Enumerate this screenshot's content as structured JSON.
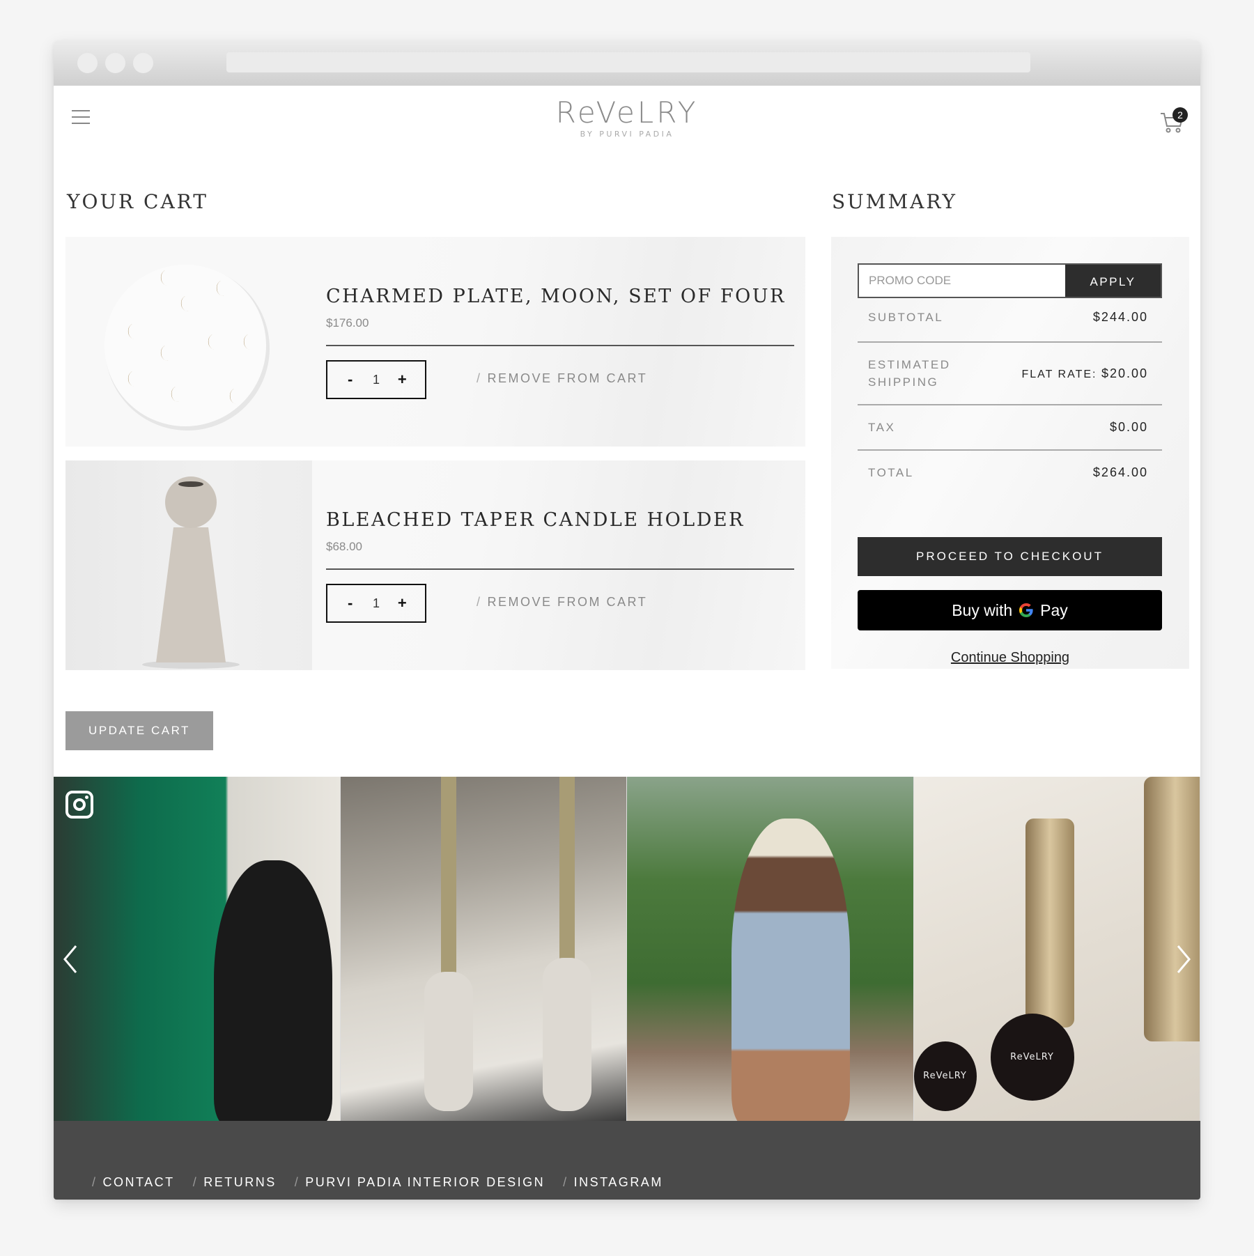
{
  "browser": {
    "address": ""
  },
  "header": {
    "logo_main": "ReVeLRY",
    "logo_sub": "BY PURVI PADIA",
    "cart_count": "2",
    "menu_icon": "hamburger-icon",
    "cart_icon": "cart-icon"
  },
  "cart": {
    "title": "YOUR CART",
    "items": [
      {
        "name": "CHARMED PLATE, MOON, SET OF FOUR",
        "price": "$176.00",
        "quantity": "1",
        "decrement": "-",
        "increment": "+",
        "remove_label": "REMOVE FROM CART",
        "image": "moon-plate-image"
      },
      {
        "name": "BLEACHED TAPER CANDLE HOLDER",
        "price": "$68.00",
        "quantity": "1",
        "decrement": "-",
        "increment": "+",
        "remove_label": "REMOVE FROM CART",
        "image": "candle-holder-image"
      }
    ],
    "separator": "/",
    "update_label": "UPDATE CART"
  },
  "summary": {
    "title": "SUMMARY",
    "promo_placeholder": "PROMO CODE",
    "promo_value": "",
    "apply_label": "APPLY",
    "rows": [
      {
        "label": "SUBTOTAL",
        "value": "$244.00"
      },
      {
        "label": "ESTIMATED SHIPPING",
        "value_prefix": "FLAT RATE: ",
        "value": "$20.00"
      },
      {
        "label": "TAX",
        "value": "$0.00"
      },
      {
        "label": "TOTAL",
        "value": "$264.00"
      }
    ],
    "checkout_label": "PROCEED TO CHECKOUT",
    "gpay_prefix": "Buy with",
    "gpay_g": "G",
    "gpay_pay": "Pay",
    "continue_label": "Continue Shopping"
  },
  "instagram": {
    "icon": "instagram-icon",
    "tiles": [
      {
        "alt": "woman-in-black-dress-by-green-bar"
      },
      {
        "alt": "marble-taper-candle-holders-on-table"
      },
      {
        "alt": "woman-in-cowboy-hat-at-outdoor-dinner"
      },
      {
        "alt": "gold-candle-holders-with-revelry-logo"
      }
    ],
    "product_logo": "ReVeLRY",
    "prev_icon": "chevron-left-icon",
    "next_icon": "chevron-right-icon"
  },
  "footer": {
    "separator": "/",
    "links": [
      "CONTACT",
      "RETURNS",
      "PURVI PADIA INTERIOR DESIGN",
      "INSTAGRAM"
    ]
  },
  "colors": {
    "dark_button": "#2d2d2d",
    "update_button": "#9b9b9b",
    "footer_bg": "#4a4a4a",
    "badge": "#222222"
  }
}
